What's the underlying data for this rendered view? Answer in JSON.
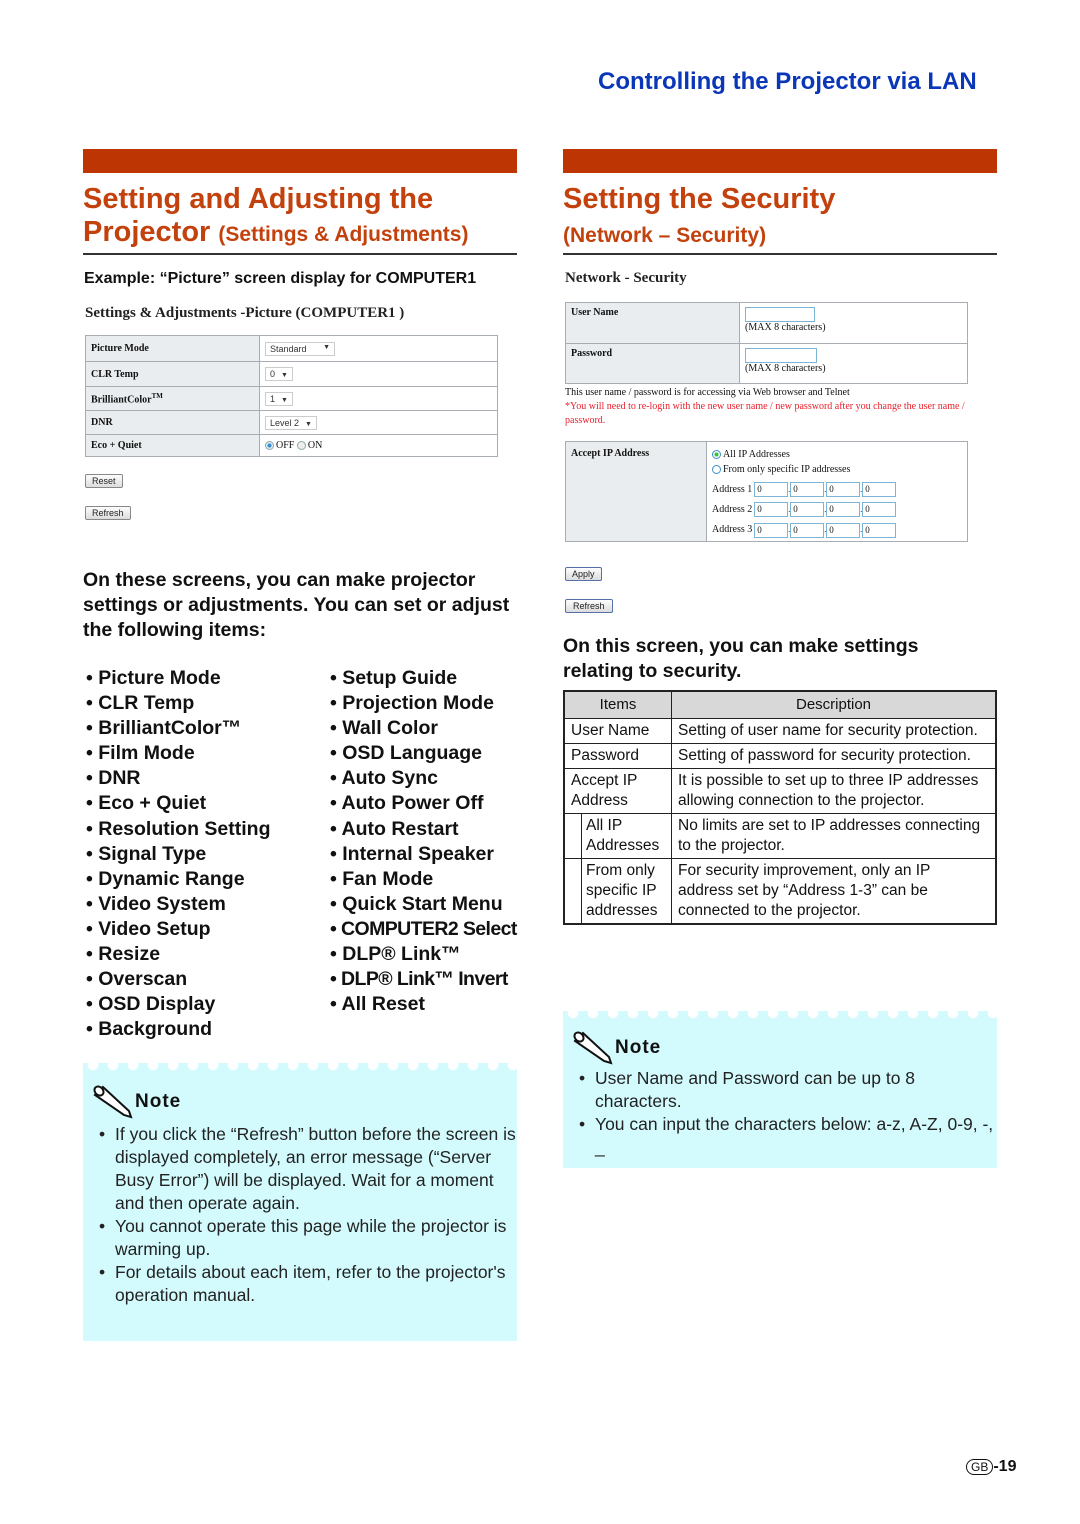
{
  "running_head": "Controlling the Projector via LAN",
  "left": {
    "title_line1": "Setting and Adjusting the",
    "title_line2_main": "Projector",
    "title_line2_sub": "(Settings & Adjustments)",
    "example_caption": "Example:  “Picture” screen display for COMPUTER1",
    "web": {
      "title": "Settings & Adjustments -Picture (COMPUTER1 )",
      "rows": [
        {
          "label": "Picture Mode",
          "value": "Standard",
          "type": "select"
        },
        {
          "label": "CLR Temp",
          "value": "0",
          "type": "select"
        },
        {
          "label": "BrilliantColor",
          "label_sup": "TM",
          "value": "1",
          "type": "select"
        },
        {
          "label": "DNR",
          "value": "Level 2",
          "type": "select"
        },
        {
          "label": "Eco + Quiet",
          "type": "radio",
          "options": [
            "OFF",
            "ON"
          ],
          "selected": "OFF"
        }
      ],
      "reset_label": "Reset",
      "refresh_label": "Refresh"
    },
    "lead": "On these screens, you can make projector settings or adjustments. You can set or adjust the following items:",
    "items_col1": [
      "Picture Mode",
      "CLR Temp",
      "BrilliantColor™",
      "Film Mode",
      "DNR",
      "Eco + Quiet",
      "Resolution Setting",
      "Signal Type",
      "Dynamic Range",
      "Video System",
      "Video Setup",
      "Resize",
      "Overscan",
      "OSD Display",
      "Background"
    ],
    "items_col2": [
      "Setup Guide",
      "Projection Mode",
      "Wall Color",
      "OSD Language",
      "Auto Sync",
      "Auto Power Off",
      "Auto Restart",
      "Internal Speaker",
      "Fan Mode",
      "Quick Start Menu",
      "COMPUTER2 Select",
      "DLP® Link™",
      "DLP® Link™ Invert",
      "All Reset"
    ],
    "note": {
      "heading": "Note",
      "items": [
        "If you click the “Refresh” button before the screen is displayed completely, an error message (“Server Busy Error”) will be displayed. Wait for a moment and then operate again.",
        "You cannot operate this page while the projector is warming up.",
        "For details about each item, refer to the projector's operation manual."
      ]
    }
  },
  "right": {
    "title_line1": "Setting the Security",
    "title_line2": "(Network – Security)",
    "web": {
      "title": "Network - Security",
      "user_name_label": "User Name",
      "password_label": "Password",
      "max_hint": "(MAX 8 characters)",
      "info_text": "This user name / password is for accessing via Web browser and Telnet",
      "warning_text": "*You will need to re-login with the new user name / new password after you change the user name / password.",
      "accept_ip_label": "Accept IP Address",
      "radio_all": "All IP Addresses",
      "radio_specific": "From only specific IP addresses",
      "radio_selected": "All IP Addresses",
      "addresses": [
        {
          "label": "Address 1",
          "octets": [
            "0",
            "0",
            "0",
            "0"
          ]
        },
        {
          "label": "Address 2",
          "octets": [
            "0",
            "0",
            "0",
            "0"
          ]
        },
        {
          "label": "Address 3",
          "octets": [
            "0",
            "0",
            "0",
            "0"
          ]
        }
      ],
      "apply_label": "Apply",
      "refresh_label": "Refresh"
    },
    "lead": "On this screen, you can make settings relating to security.",
    "table": {
      "headers": [
        "Items",
        "Description"
      ],
      "rows": [
        {
          "item": "User Name",
          "desc": "Setting of user name for security protection.",
          "indent": false
        },
        {
          "item": "Password",
          "desc": "Setting of password for security protection.",
          "indent": false
        },
        {
          "item": "Accept IP Address",
          "desc": "It is possible to set up to three IP addresses allowing connection to the projector.",
          "indent": false
        },
        {
          "item": "All IP Addresses",
          "desc": "No limits are set to IP addresses connecting to the projector.",
          "indent": true
        },
        {
          "item": "From only specific IP addresses",
          "desc": "For security improvement, only an IP address set by “Address 1-3” can be connected to the projector.",
          "indent": true
        }
      ]
    },
    "note": {
      "heading": "Note",
      "items": [
        "User Name and Password can be up to 8 characters.",
        "You can input the characters below: a-z, A-Z, 0-9, -, _"
      ]
    }
  },
  "footer": {
    "region_badge": "GB",
    "page_number": "-19"
  }
}
